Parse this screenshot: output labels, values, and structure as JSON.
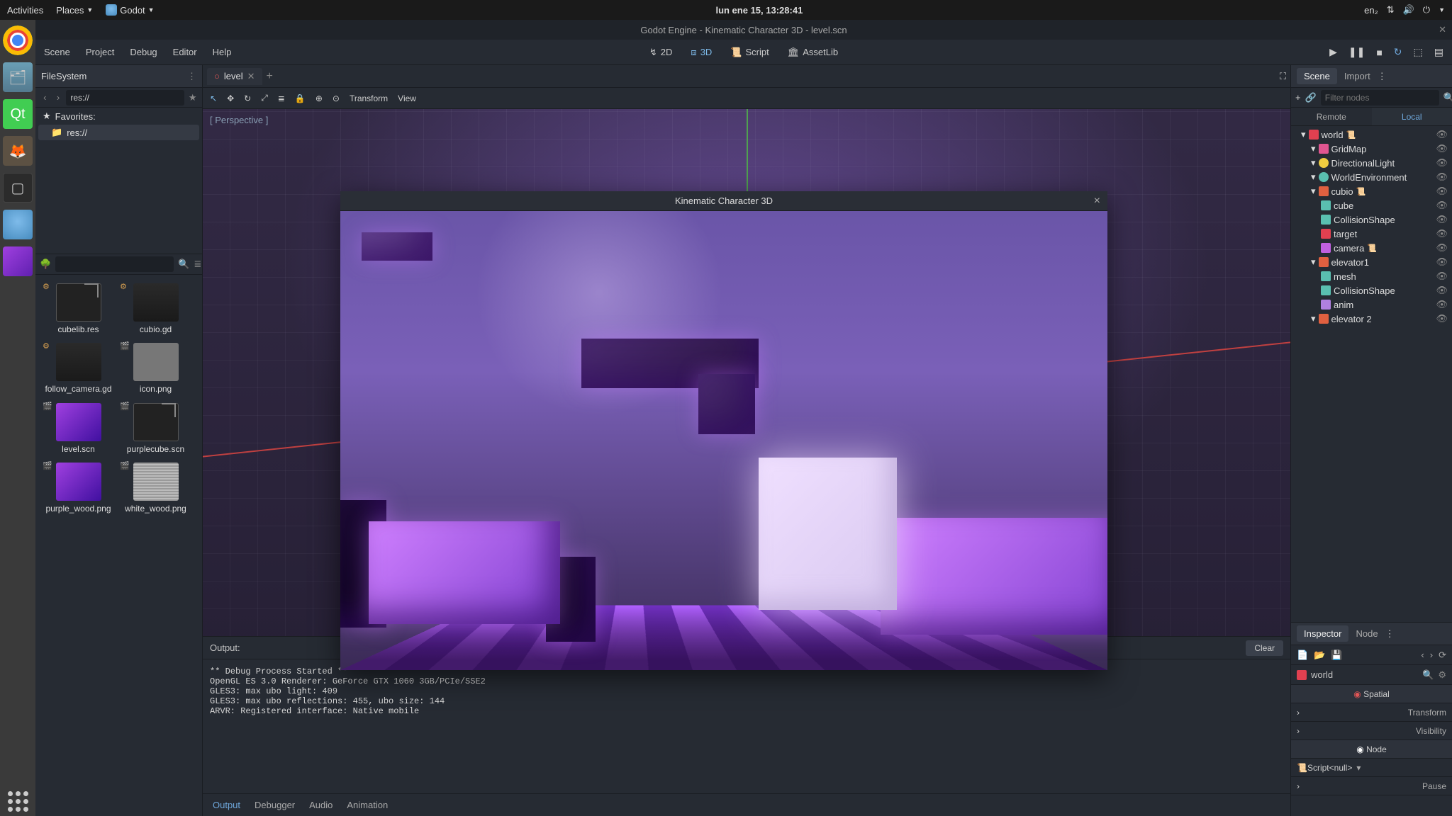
{
  "sysbar": {
    "activities": "Activities",
    "places": "Places",
    "app": "Godot",
    "datetime": "lun ene 15, 13:28:41",
    "lang": "en₂"
  },
  "titlebar": "Godot Engine - Kinematic Character 3D - level.scn",
  "menu": {
    "scene": "Scene",
    "project": "Project",
    "debug": "Debug",
    "editor": "Editor",
    "help": "Help"
  },
  "workspace": {
    "2d": "2D",
    "3d": "3D",
    "script": "Script",
    "assetlib": "AssetLib"
  },
  "filesystem": {
    "title": "FileSystem",
    "path": "res://",
    "favorites": "Favorites:",
    "root": "res://",
    "files": [
      {
        "name": "cubelib.res"
      },
      {
        "name": "cubio.gd"
      },
      {
        "name": "follow_camera.gd"
      },
      {
        "name": "icon.png"
      },
      {
        "name": "level.scn"
      },
      {
        "name": "purplecube.scn"
      },
      {
        "name": "purple_wood.png"
      },
      {
        "name": "white_wood.png"
      }
    ]
  },
  "scene_tab": "level",
  "viewport": {
    "perspective": "[ Perspective ]",
    "transform": "Transform",
    "view": "View"
  },
  "output": {
    "title": "Output:",
    "clear": "Clear",
    "log": "** Debug Process Started **\nOpenGL ES 3.0 Renderer: GeForce GTX 1060 3GB/PCIe/SSE2\nGLES3: max ubo light: 409\nGLES3: max ubo reflections: 455, ubo size: 144\nARVR: Registered interface: Native mobile",
    "tabs": {
      "output": "Output",
      "debugger": "Debugger",
      "audio": "Audio",
      "animation": "Animation"
    }
  },
  "scene_panel": {
    "title": "Scene",
    "import_tab": "Import",
    "filter_placeholder": "Filter nodes",
    "remote": "Remote",
    "local": "Local",
    "nodes": [
      {
        "name": "world",
        "indent": 0,
        "ico": "world",
        "script": true
      },
      {
        "name": "GridMap",
        "indent": 1,
        "ico": "grid"
      },
      {
        "name": "DirectionalLight",
        "indent": 1,
        "ico": "light"
      },
      {
        "name": "WorldEnvironment",
        "indent": 1,
        "ico": "env"
      },
      {
        "name": "cubio",
        "indent": 1,
        "ico": "kine",
        "script": true
      },
      {
        "name": "cube",
        "indent": 2,
        "ico": "mesh"
      },
      {
        "name": "CollisionShape",
        "indent": 2,
        "ico": "coll"
      },
      {
        "name": "target",
        "indent": 2,
        "ico": "spatial"
      },
      {
        "name": "camera",
        "indent": 2,
        "ico": "cam",
        "script": true
      },
      {
        "name": "elevator1",
        "indent": 1,
        "ico": "kine"
      },
      {
        "name": "mesh",
        "indent": 2,
        "ico": "mesh"
      },
      {
        "name": "CollisionShape",
        "indent": 2,
        "ico": "coll"
      },
      {
        "name": "anim",
        "indent": 2,
        "ico": "anim"
      },
      {
        "name": "elevator 2",
        "indent": 1,
        "ico": "kine"
      }
    ]
  },
  "inspector": {
    "title": "Inspector",
    "node_tab": "Node",
    "obj": "world",
    "spatial": "Spatial",
    "transform": "Transform",
    "visibility": "Visibility",
    "node_sec": "Node",
    "script_label": "Script",
    "script_val": "<null>",
    "pause": "Pause"
  },
  "game_window": {
    "title": "Kinematic Character 3D"
  }
}
